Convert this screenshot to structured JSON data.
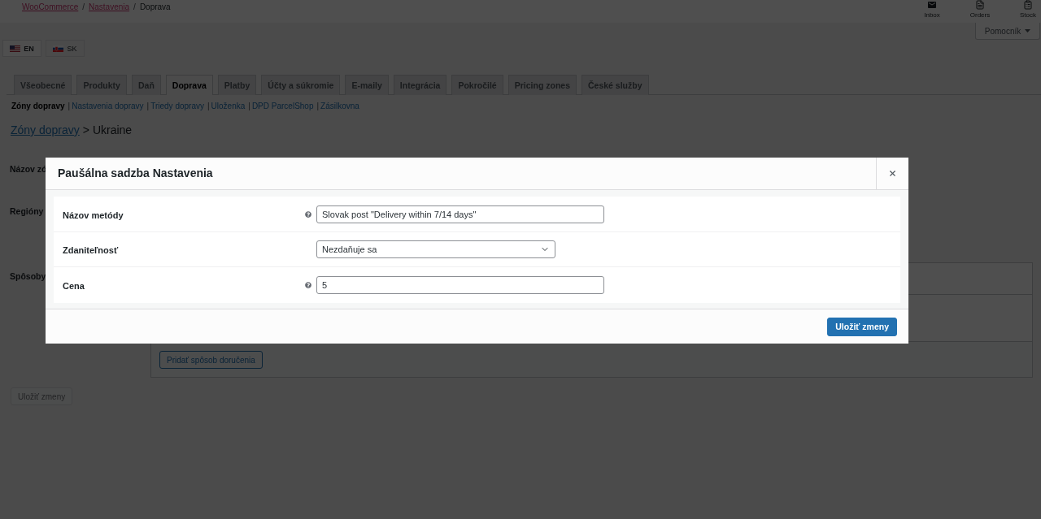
{
  "header": {
    "breadcrumbs": [
      {
        "kind": "link",
        "label": "WooCommerce"
      },
      {
        "kind": "separator",
        "label": "/"
      },
      {
        "kind": "link",
        "label": "Nastavenia"
      },
      {
        "kind": "separator",
        "label": "/"
      },
      {
        "kind": "current",
        "label": "Doprava"
      }
    ],
    "activity_items": [
      {
        "kind": "inbox",
        "label": "Inbox"
      },
      {
        "kind": "orders",
        "label": "Orders"
      },
      {
        "kind": "stock",
        "label": "Stock"
      }
    ]
  },
  "help_tab": {
    "label": "Pomocník"
  },
  "language_tabs": [
    {
      "kind": "us",
      "label": "EN",
      "selected": true
    },
    {
      "kind": "sk",
      "label": "SK",
      "selected": false
    }
  ],
  "settings_tabs": [
    {
      "label": "Všeobecné",
      "selected": false
    },
    {
      "label": "Produkty",
      "selected": false
    },
    {
      "label": "Daň",
      "selected": false
    },
    {
      "label": "Doprava",
      "selected": true
    },
    {
      "label": "Platby",
      "selected": false
    },
    {
      "label": "Účty a súkromie",
      "selected": false
    },
    {
      "label": "E-maily",
      "selected": false
    },
    {
      "label": "Integrácia",
      "selected": false
    },
    {
      "label": "Pokročilé",
      "selected": false
    },
    {
      "label": "Pricing zones",
      "selected": false
    },
    {
      "label": "České služby",
      "selected": false
    }
  ],
  "sub_nav": [
    {
      "label": "Zóny dopravy",
      "selected": true
    },
    {
      "label": "Nastavenia dopravy",
      "selected": false,
      "separator": "|"
    },
    {
      "label": "Triedy dopravy",
      "selected": false,
      "separator": "|"
    },
    {
      "label": "Uloženka",
      "selected": false,
      "separator": "|"
    },
    {
      "label": "DPD ParcelShop",
      "selected": false,
      "separator": "|"
    },
    {
      "label": "Zásilkovna",
      "selected": false,
      "separator": "|"
    }
  ],
  "page_heading": {
    "link": "Zóny dopravy",
    "rest": "> Ukraine"
  },
  "zone_form": {
    "name_label": "Názov zó",
    "regions_label": "Regióny",
    "methods_label": "Spôsoby",
    "add_method_button": "Pridať spôsob doručenia",
    "save_button": {
      "label": "Uložiť zmeny",
      "disabled": true
    }
  },
  "modal": {
    "title": "Paušálna sadzba Nastavenia",
    "fields": [
      {
        "kind": "text",
        "label": "Názov metódy",
        "value": "Slovak post \"Delivery within 7/14 days\"",
        "help": true
      },
      {
        "kind": "select",
        "label": "Zdaniteľnosť",
        "value": "Nezdaňuje sa",
        "help": false
      },
      {
        "kind": "text",
        "label": "Cena",
        "value": "5",
        "help": true
      }
    ],
    "save_button": "Uložiť zmeny"
  }
}
